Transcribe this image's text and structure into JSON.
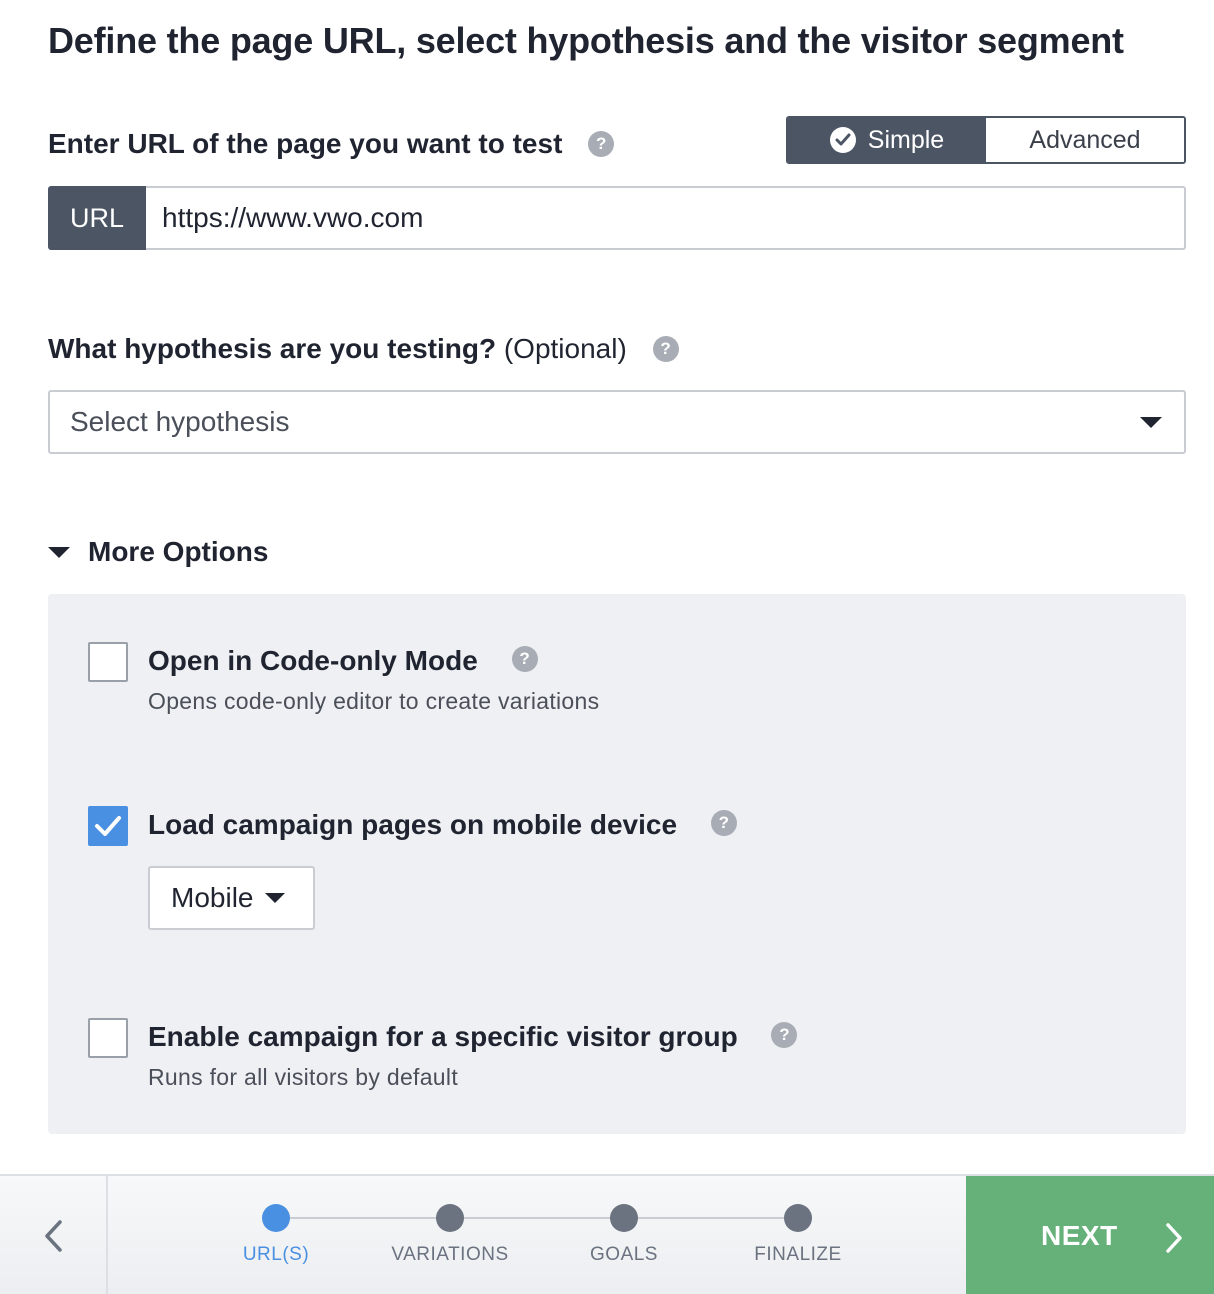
{
  "page": {
    "title": "Define the page URL, select hypothesis and the visitor segment"
  },
  "url_section": {
    "label": "Enter URL of the page you want to test",
    "mode_toggle": {
      "simple_label": "Simple",
      "advanced_label": "Advanced",
      "selected": "Simple"
    },
    "prefix_label": "URL",
    "value": "https://www.vwo.com"
  },
  "hypothesis": {
    "label": "What hypothesis are you testing?",
    "optional_label": "(Optional)",
    "placeholder": "Select hypothesis"
  },
  "more_options": {
    "label": "More Options",
    "expanded": true,
    "options": [
      {
        "title": "Open in Code-only Mode",
        "subtitle": "Opens code-only editor to create variations",
        "checked": false
      },
      {
        "title": "Load campaign pages on mobile device",
        "checked": true,
        "device_select": "Mobile"
      },
      {
        "title": "Enable campaign for a specific visitor group",
        "subtitle": "Runs for all visitors by default",
        "checked": false
      }
    ]
  },
  "footer": {
    "steps": [
      {
        "label": "URL(S)",
        "active": true
      },
      {
        "label": "VARIATIONS",
        "active": false
      },
      {
        "label": "GOALS",
        "active": false
      },
      {
        "label": "FINALIZE",
        "active": false
      }
    ],
    "next_label": "NEXT"
  },
  "icons": {
    "help": "question-mark-icon",
    "back": "chevron-left-icon",
    "next": "chevron-right-icon",
    "dropdown": "caret-down-icon",
    "check": "checkmark-icon"
  },
  "colors": {
    "dark_gray": "#4b5563",
    "accent_blue": "#4a90e2",
    "next_green": "#66b07a",
    "panel_bg": "#eef0f3"
  }
}
